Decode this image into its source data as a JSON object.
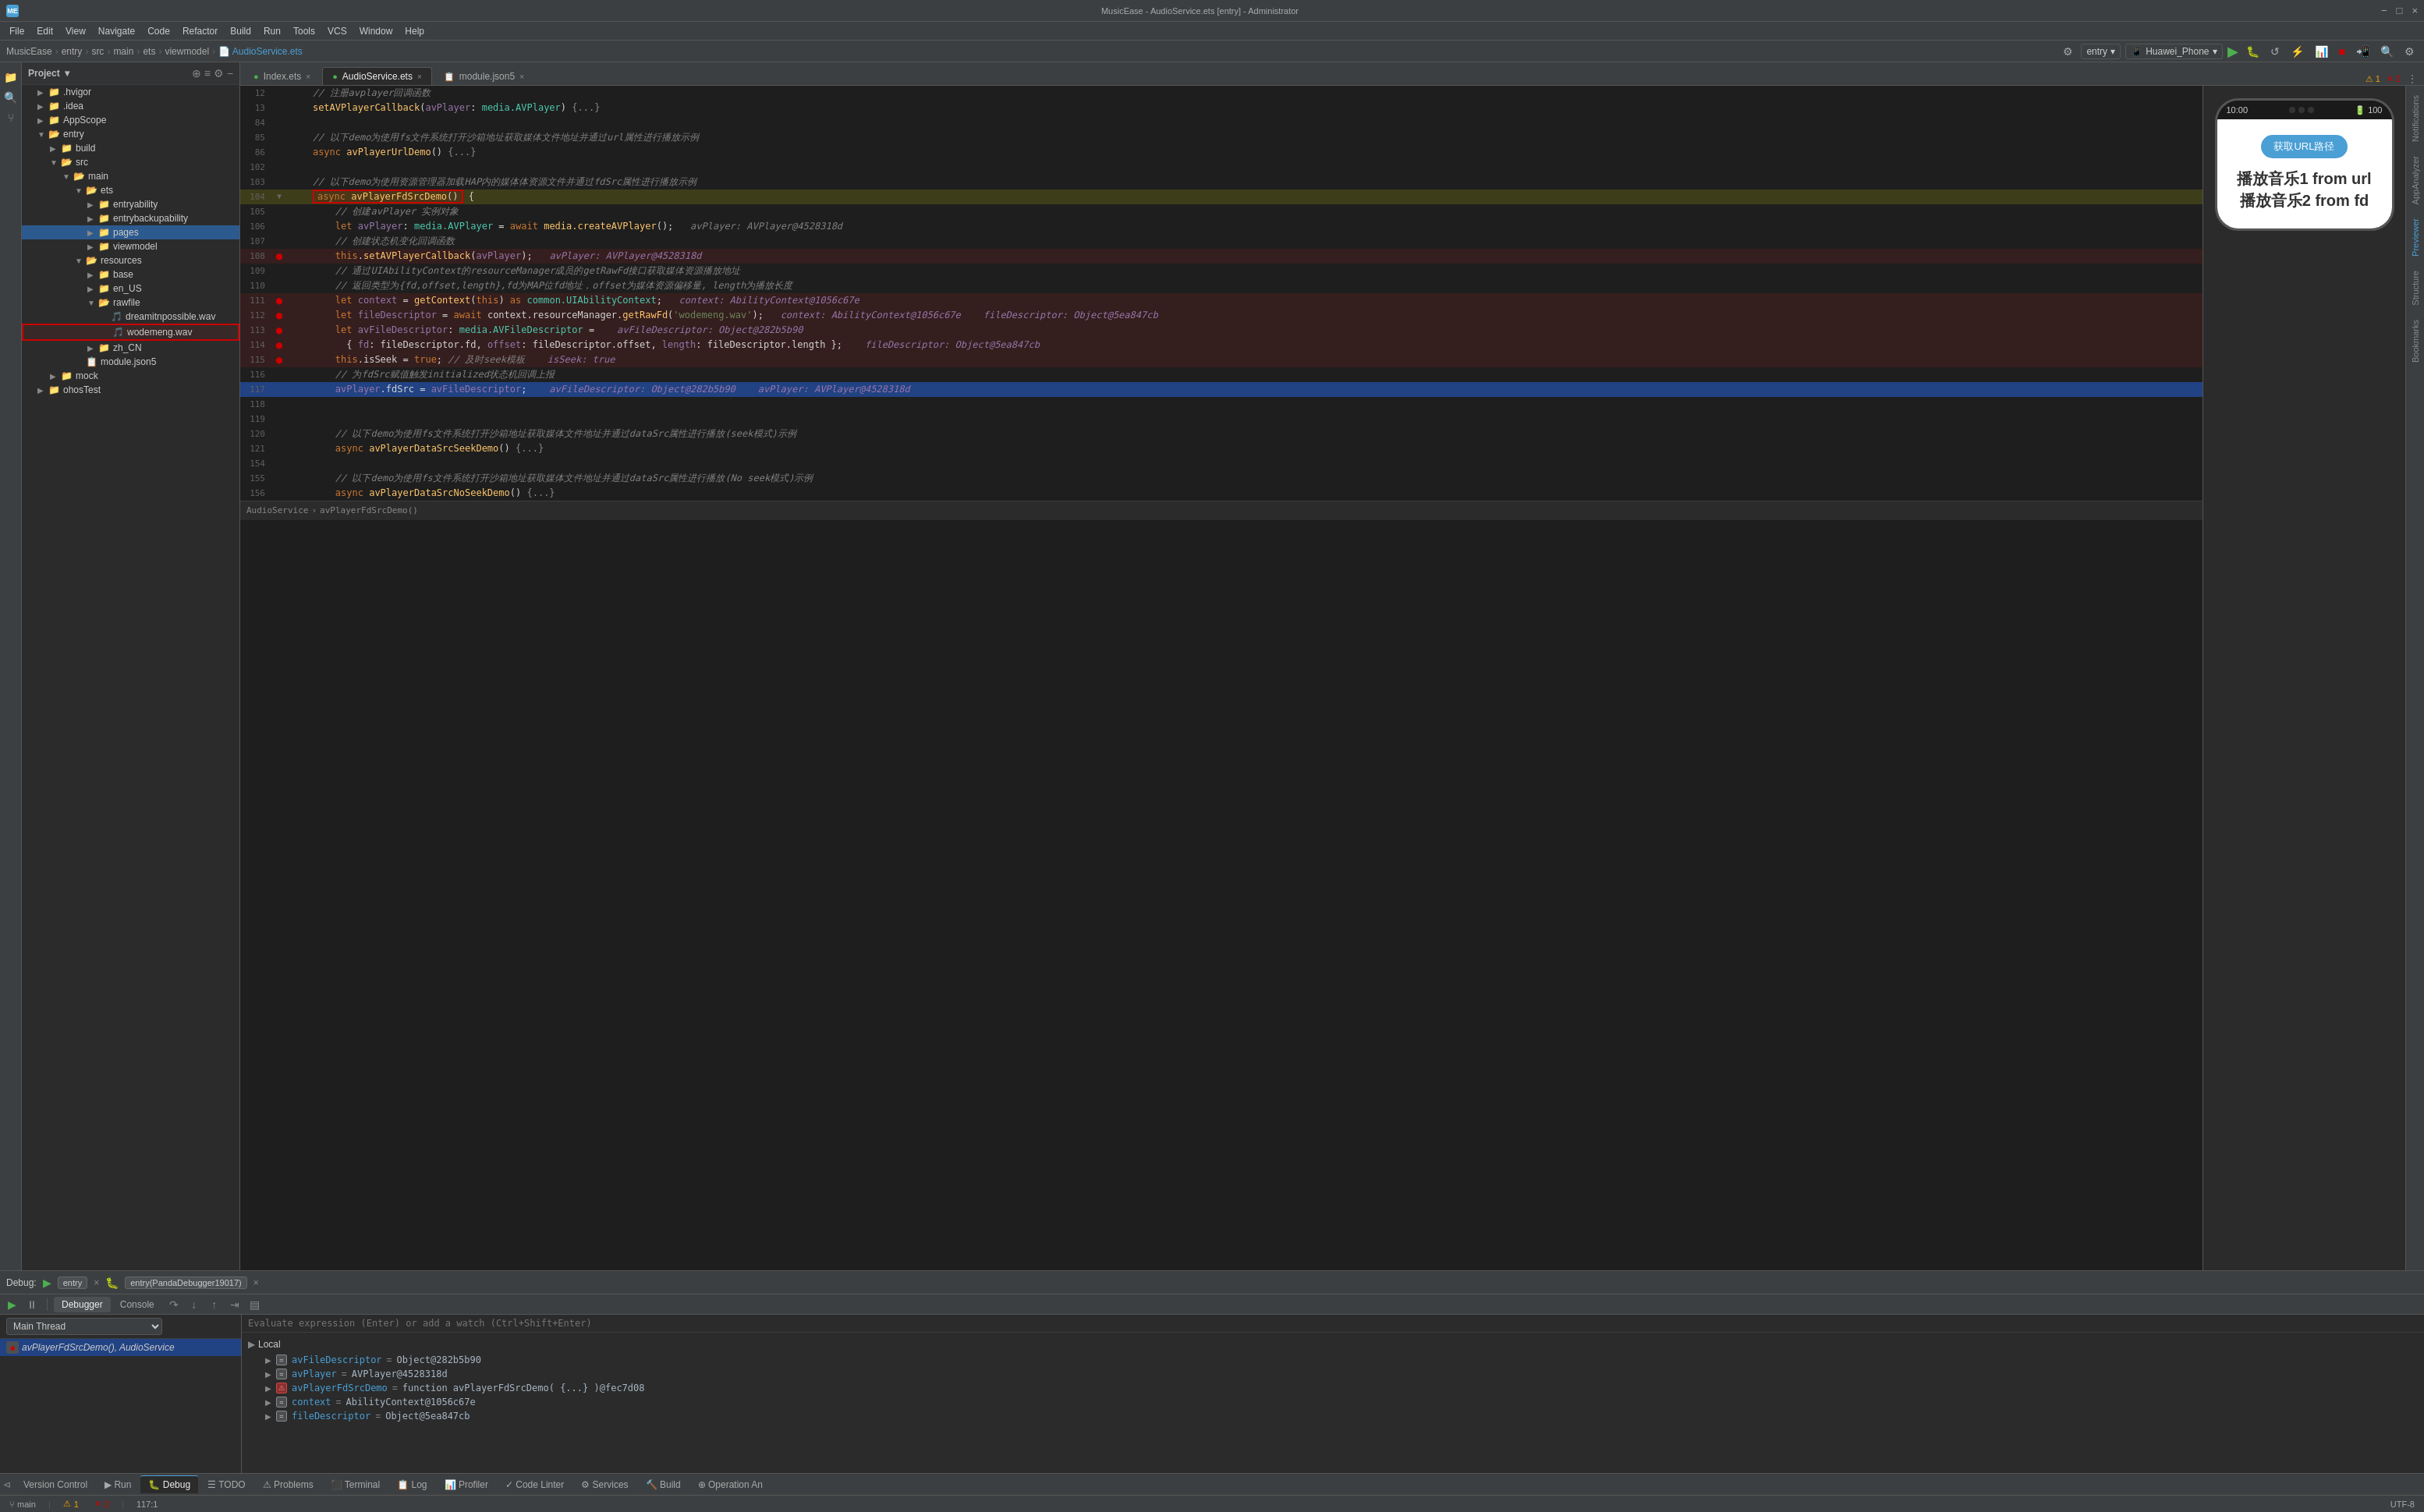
{
  "app": {
    "title": "MusicEase - AudioService.ets [entry] - Administrator",
    "icon_label": "ME"
  },
  "title_bar": {
    "title": "MusicEase - AudioService.ets [entry] - Administrator",
    "minimize": "−",
    "maximize": "□",
    "close": "×"
  },
  "menu": {
    "items": [
      "File",
      "Edit",
      "View",
      "Navigate",
      "Code",
      "Refactor",
      "Build",
      "Run",
      "Tools",
      "VCS",
      "Window",
      "Help"
    ]
  },
  "breadcrumb": {
    "parts": [
      "MusicEase",
      "entry",
      "src",
      "main",
      "ets",
      "viewmodel",
      "AudioService.ets"
    ]
  },
  "toolbar": {
    "entry_label": "entry",
    "device_label": "Huawei_Phone",
    "search_icon": "🔍",
    "settings_icon": "⚙"
  },
  "editor_tabs": [
    {
      "name": "Index.ets",
      "icon": "📄",
      "active": false,
      "closable": true
    },
    {
      "name": "AudioService.ets",
      "icon": "📄",
      "active": true,
      "closable": true
    },
    {
      "name": "module.json5",
      "icon": "📋",
      "active": false,
      "closable": true
    }
  ],
  "code_lines": [
    {
      "num": 12,
      "content": "    // 注册avplayer回调函数",
      "type": "comment"
    },
    {
      "num": 13,
      "content": "    setAVPlayerCallback(avPlayer: media.AVPlayer) {...}",
      "type": "code"
    },
    {
      "num": 84,
      "content": "",
      "type": "empty"
    },
    {
      "num": 85,
      "content": "    // 以下demo为使用fs文件系统打开沙箱地址获取媒体文件地址并通过url属性进行播放示例",
      "type": "comment"
    },
    {
      "num": 86,
      "content": "    async avPlayerUrlDemo() {...}",
      "type": "code"
    },
    {
      "num": 102,
      "content": "",
      "type": "empty"
    },
    {
      "num": 103,
      "content": "    // 以下demo为使用资源管理器加载HAP内的媒体体资源文件并通过fdSrc属性进行播放示例",
      "type": "comment"
    },
    {
      "num": 104,
      "content": "    async avPlayerFdSrcDemo() {",
      "type": "code_highlighted",
      "red_box": true
    },
    {
      "num": 105,
      "content": "        // 创建avPlayer 实例对象",
      "type": "comment"
    },
    {
      "num": 106,
      "content": "        let avPlayer: media.AVPlayer = await media.createAVPlayer();   avPlayer: AVPlayer@4528318d",
      "type": "code"
    },
    {
      "num": 107,
      "content": "        // 创建状态机变化回调函数",
      "type": "comment"
    },
    {
      "num": 108,
      "content": "        this.setAVPlayerCallback(avPlayer);   avPlayer: AVPlayer@4528318d",
      "type": "code_bp",
      "breakpoint": true
    },
    {
      "num": 109,
      "content": "        // 通过UIAbilityContext的resourceManager成员的getRawFd接口获取媒体资源播放地址",
      "type": "comment"
    },
    {
      "num": 110,
      "content": "        // 返回类型为{fd,offset,length},fd为MAP位fd地址，offset为媒体资源偏移量, length为播放长度",
      "type": "comment"
    },
    {
      "num": 111,
      "content": "        let context = getContext(this) as common.UIAbilityContext;   context: AbilityContext@1056c67e",
      "type": "code_bp",
      "breakpoint": true
    },
    {
      "num": 112,
      "content": "        let fileDescriptor = await context.resourceManager.getRawFd('wodemeng.wav');   context: AbilityContext@1056c67e    fileDescriptor: Object@5ea847cb",
      "type": "code_bp",
      "breakpoint": true
    },
    {
      "num": 113,
      "content": "        let avFileDescriptor: media.AVFileDescriptor =    avFileDescriptor: Object@282b5b90",
      "type": "code_bp",
      "breakpoint": true
    },
    {
      "num": 114,
      "content": "          { fd: fileDescriptor.fd, offset: fileDescriptor.offset, length: fileDescriptor.length };    fileDescriptor: Object@5ea847cb",
      "type": "code_bp",
      "breakpoint": true
    },
    {
      "num": 115,
      "content": "        this.isSeek = true; // 及时seek模板    isSeek: true",
      "type": "code_bp",
      "breakpoint": true
    },
    {
      "num": 116,
      "content": "        // 为fdSrc赋值触发initialized状态机回调上报",
      "type": "comment"
    },
    {
      "num": 117,
      "content": "        avPlayer.fdSrc = avFileDescriptor;    avFileDescriptor: Object@282b5b90    avPlayer: AVPlayer@4528318d",
      "type": "code_selected",
      "selected": true
    },
    {
      "num": 118,
      "content": "",
      "type": "empty"
    },
    {
      "num": 119,
      "content": "",
      "type": "empty"
    },
    {
      "num": 120,
      "content": "        // 以下demo为使用fs文件系统打开沙箱地址获取媒体文件地址并通过dataSrc属性进行播放(seek模式)示例",
      "type": "comment"
    },
    {
      "num": 121,
      "content": "        async avPlayerDataSrcSeekDemo() {...}",
      "type": "code"
    },
    {
      "num": 154,
      "content": "",
      "type": "empty"
    },
    {
      "num": 155,
      "content": "        // 以下demo为使用fs文件系统打开沙箱地址获取媒体文件地址并通过dataSrc属性进行播放(No seek模式)示例",
      "type": "comment"
    },
    {
      "num": 156,
      "content": "        async avPlayerDataSrcNoSeekDemo() {...}",
      "type": "code"
    }
  ],
  "breadcrumb_editor": {
    "parts": [
      "AudioService",
      "avPlayerFdSrcDemo()"
    ]
  },
  "file_tree": {
    "title": "Project",
    "items": [
      {
        "level": 0,
        "label": ".hvigor",
        "type": "folder",
        "expanded": false
      },
      {
        "level": 0,
        "label": ".idea",
        "type": "folder",
        "expanded": false
      },
      {
        "level": 0,
        "label": "AppScope",
        "type": "folder",
        "expanded": false
      },
      {
        "level": 0,
        "label": "entry",
        "type": "folder",
        "expanded": true
      },
      {
        "level": 1,
        "label": "build",
        "type": "folder",
        "expanded": false
      },
      {
        "level": 1,
        "label": "src",
        "type": "folder",
        "expanded": true
      },
      {
        "level": 2,
        "label": "main",
        "type": "folder",
        "expanded": true
      },
      {
        "level": 3,
        "label": "ets",
        "type": "folder",
        "expanded": true
      },
      {
        "level": 4,
        "label": "entryability",
        "type": "folder",
        "expanded": false
      },
      {
        "level": 4,
        "label": "entrybackupability",
        "type": "folder",
        "expanded": false
      },
      {
        "level": 4,
        "label": "pages",
        "type": "folder",
        "expanded": false,
        "selected": true
      },
      {
        "level": 4,
        "label": "viewmodel",
        "type": "folder",
        "expanded": false
      },
      {
        "level": 3,
        "label": "resources",
        "type": "folder",
        "expanded": true
      },
      {
        "level": 4,
        "label": "base",
        "type": "folder",
        "expanded": false
      },
      {
        "level": 4,
        "label": "en_US",
        "type": "folder",
        "expanded": false
      },
      {
        "level": 4,
        "label": "rawfile",
        "type": "folder",
        "expanded": true
      },
      {
        "level": 5,
        "label": "dreamitnpossible.wav",
        "type": "wav"
      },
      {
        "level": 5,
        "label": "wodemeng.wav",
        "type": "wav",
        "highlighted": true
      },
      {
        "level": 4,
        "label": "zh_CN",
        "type": "folder",
        "expanded": false
      },
      {
        "level": 3,
        "label": "module.json5",
        "type": "json"
      },
      {
        "level": 1,
        "label": "mock",
        "type": "folder",
        "expanded": false
      },
      {
        "level": 0,
        "label": "ohosTest",
        "type": "folder",
        "expanded": false
      }
    ]
  },
  "debug": {
    "label": "Debug:",
    "session1": "entry",
    "session2": "entry(PandaDebugger19017)",
    "tabs": [
      "Debugger",
      "Console"
    ],
    "toolbar_buttons": [
      "▶",
      "⏸",
      "≡",
      "↑",
      "↓",
      "⇓",
      "↑",
      "⇤",
      "▤"
    ],
    "thread_label": "Main Thread",
    "frame": "avPlayerFdSrcDemo(), AudioService",
    "expr_placeholder": "Evaluate expression (Enter) or add a watch (Ctrl+Shift+Enter)",
    "locals_label": "Local",
    "variables": [
      {
        "name": "avFileDescriptor",
        "value": "= Object@282b5b90",
        "icon": "eq",
        "expanded": false
      },
      {
        "name": "avPlayer",
        "value": "= AVPlayer@4528318d",
        "icon": "eq",
        "expanded": false
      },
      {
        "name": "avPlayerFdSrcDemo",
        "value": "= function avPlayerFdSrcDemo( {...} )@fec7d08",
        "icon": "warn",
        "expanded": false
      },
      {
        "name": "context",
        "value": "= AbilityContext@1056c67e",
        "icon": "eq",
        "expanded": false
      },
      {
        "name": "fileDescriptor",
        "value": "= Object@5ea847cb",
        "icon": "eq",
        "expanded": false
      }
    ]
  },
  "phone_preview": {
    "time": "10:00",
    "battery": "100",
    "btn_label": "获取URL路径",
    "text1": "播放音乐1 from url",
    "text2": "播放音乐2 from fd"
  },
  "right_vtabs": [
    "Notifications",
    "AppAnalyzer",
    "Previewer",
    "Structure",
    "Bookmarks"
  ],
  "bottom_tabs": [
    "Version Control",
    "Run",
    "Debug",
    "TODO",
    "Problems",
    "Terminal",
    "Log",
    "Profiler",
    "Code Linter",
    "Services",
    "Build",
    "Operation An"
  ],
  "status_bar": {
    "warnings": "1",
    "errors": "2",
    "encoding": "UTF-8",
    "line_col": "117:1"
  },
  "warnings_indicator": "⚠ 1",
  "errors_indicator": "✕ 2"
}
